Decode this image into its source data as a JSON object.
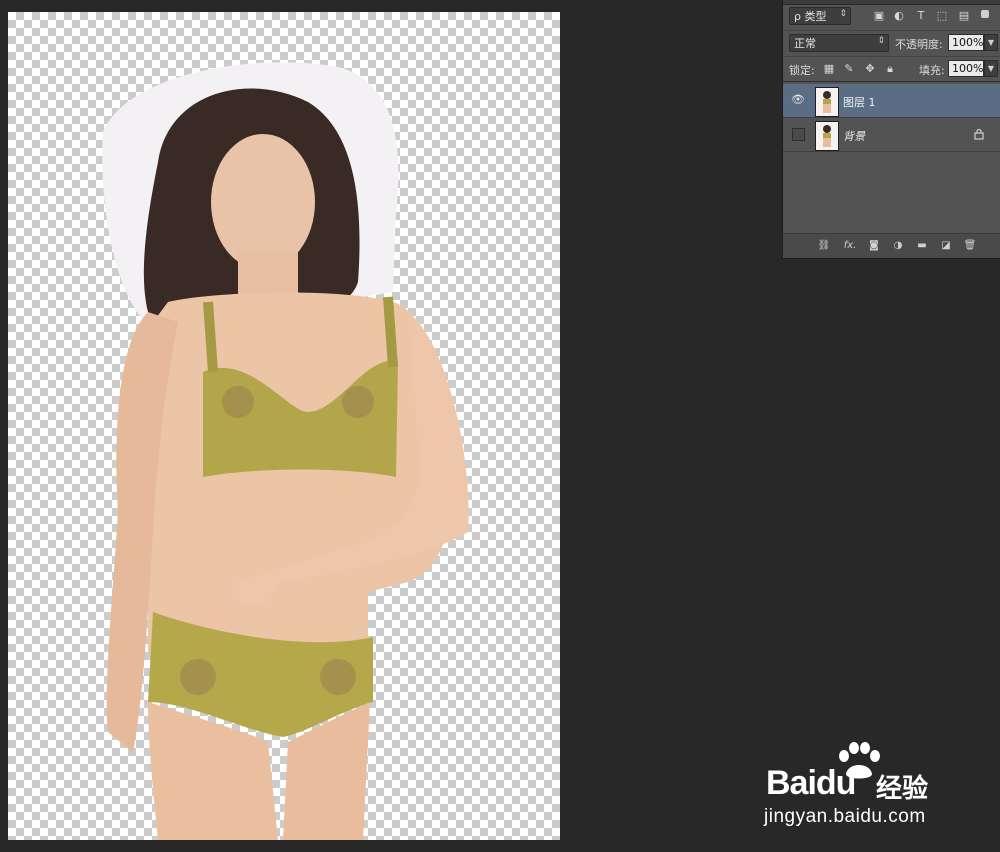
{
  "layers_panel": {
    "filter": {
      "label": "ρ 类型"
    },
    "blend_mode": {
      "value": "正常"
    },
    "opacity": {
      "label": "不透明度:",
      "value": "100%"
    },
    "lock": {
      "label": "锁定:"
    },
    "fill": {
      "label": "填充:",
      "value": "100%"
    },
    "layers": [
      {
        "name": "图层 1",
        "visible": true,
        "selected": true,
        "locked": false
      },
      {
        "name": "背景",
        "visible": false,
        "selected": false,
        "locked": true
      }
    ],
    "filter_icons": [
      "image-filter-icon",
      "adjustment-filter-icon",
      "type-filter-icon",
      "shape-filter-icon",
      "smart-object-filter-icon"
    ],
    "footer_icons": [
      "link-icon",
      "fx-icon",
      "mask-icon",
      "adjustment-layer-icon",
      "group-folder-icon",
      "new-layer-icon",
      "trash-icon"
    ]
  },
  "watermark": {
    "brand_text": "Baidu",
    "brand_cn": "经验",
    "url": "jingyan.baidu.com"
  },
  "colors": {
    "workspace_bg": "#282828",
    "panel_bg": "#535353",
    "selected_layer": "#5b6c85"
  }
}
